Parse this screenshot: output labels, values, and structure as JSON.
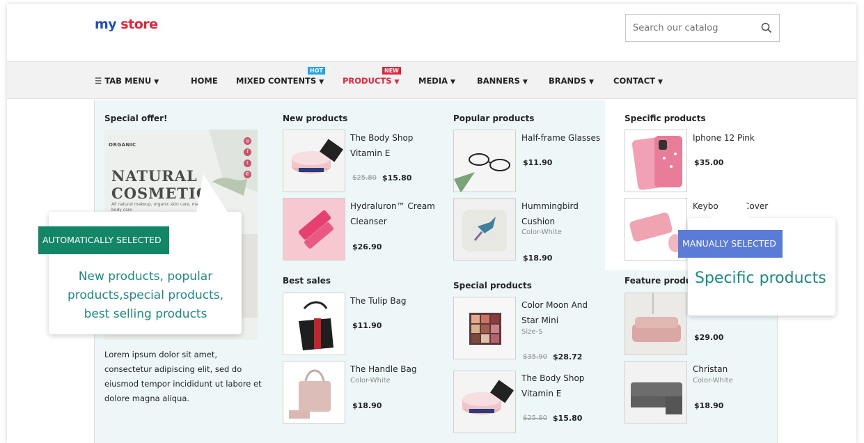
{
  "header": {
    "logo": {
      "part1": "my",
      "part2": " store"
    },
    "search": {
      "placeholder": "Search our catalog",
      "icon": "search-icon"
    }
  },
  "nav": {
    "items": [
      {
        "label": "TAB MENU",
        "icon": "hamburger-icon",
        "caret": "▼"
      },
      {
        "label": "HOME"
      },
      {
        "label": "MIXED CONTENTS",
        "badge": "HOT",
        "caret": "▼"
      },
      {
        "label": "PRODUCTS",
        "badge": "NEW",
        "caret": "▼",
        "active": true
      },
      {
        "label": "MEDIA",
        "caret": "▼"
      },
      {
        "label": "BANNERS",
        "caret": "▼"
      },
      {
        "label": "BRANDS",
        "caret": "▼"
      },
      {
        "label": "CONTACT",
        "caret": "▼"
      }
    ]
  },
  "colors": {
    "accent_red": "#e3243b",
    "hot_blue": "#22a5e8",
    "auto_green": "#138668",
    "manual_blue": "#5a7bd6",
    "callout_text": "#1b8a86",
    "panel_bg": "#eef7f7"
  },
  "mega": {
    "special_offer": {
      "title": "Special offer!",
      "banner": {
        "brand": "ORGANIC",
        "headline1": "NATURAL",
        "headline2": "COSMETIC",
        "small": "All natural makeup, organic skin care, makeup, & body care"
      },
      "lorem": "Lorem ipsum dolor sit amet, consectetur adipiscing elit, sed do eiusmod tempor incididunt ut labore et dolore magna aliqua."
    },
    "new_products": {
      "title": "New products",
      "items": [
        {
          "name": "The Body Shop Vitamin E",
          "old_price": "$25.80",
          "price": "$15.80",
          "thumb": "cream-jar"
        },
        {
          "name": "Hydraluron™ Cream Cleanser",
          "price": "$26.90",
          "thumb": "cleanser-tubes"
        }
      ]
    },
    "best_sales": {
      "title": "Best sales",
      "items": [
        {
          "name": "The Tulip Bag",
          "price": "$11.90",
          "thumb": "black-bag"
        },
        {
          "name": "The Handle Bag",
          "attr": "Color-White",
          "price": "$18.90",
          "thumb": "pink-handbag"
        }
      ]
    },
    "popular_products": {
      "title": "Popular products",
      "items": [
        {
          "name": "Half-frame Glasses",
          "price": "$11.90",
          "thumb": "glasses"
        },
        {
          "name": "Hummingbird Cushion",
          "attr": "Color-White",
          "price": "$18.90",
          "thumb": "cushion"
        }
      ]
    },
    "special_products": {
      "title": "Special products",
      "items": [
        {
          "name": "Color Moon And Star Mini",
          "attr": "Size-S",
          "old_price": "$35.90",
          "price": "$28.72",
          "thumb": "eyeshadow"
        },
        {
          "name": "The Body Shop Vitamin E",
          "old_price": "$25.80",
          "price": "$15.80",
          "thumb": "cream-jar"
        }
      ]
    },
    "specific_products": {
      "title": "Specific products",
      "items": [
        {
          "name": "Iphone 12 Pink",
          "price": "$35.00",
          "thumb": "pink-phone"
        },
        {
          "name_left": "Keybo",
          "name_right": "Cover",
          "thumb": "pink-keyboard"
        }
      ]
    },
    "feature_products": {
      "title": "Feature product",
      "items": [
        {
          "price": "$29.00",
          "thumb": "pink-sofa"
        },
        {
          "name": "Christan",
          "attr": "Color-White",
          "price": "$18.90",
          "thumb": "grey-sofa"
        }
      ]
    }
  },
  "callouts": {
    "auto": {
      "tag": "AUTOMATICALLY SELECTED",
      "line1": "New products, popular",
      "line2": "products,special products,",
      "line3": "best selling products"
    },
    "manual": {
      "tag": "MANUALLY SELECTED",
      "text": "Specific products"
    }
  }
}
